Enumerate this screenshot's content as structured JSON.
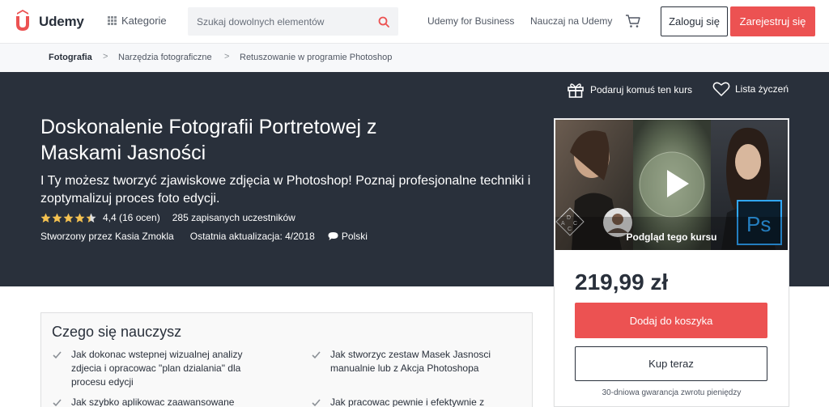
{
  "header": {
    "logo_text": "Udemy",
    "categories_label": "Kategorie",
    "search_placeholder": "Szukaj dowolnych elementów",
    "business_link": "Udemy for Business",
    "teach_link": "Nauczaj na Udemy",
    "login_label": "Zaloguj się",
    "register_label": "Zarejestruj się"
  },
  "breadcrumb": [
    "Fotografia",
    "Narzędzia fotograficzne",
    "Retuszowanie w programie Photoshop"
  ],
  "hero": {
    "gift_label": "Podaruj komuś ten kurs",
    "wishlist_label": "Lista życzeń",
    "title_line1": "Doskonalenie Fotografii Portretowej z",
    "title_line2": "Maskami Jasności",
    "subtitle": "I Ty możesz tworzyć zjawiskowe zdjęcia w Photoshop! Poznaj profesjonalne techniki i zoptymalizuj proces foto edycji.",
    "rating_value": 4.4,
    "rating_text": "4,4 (16 ocen)",
    "students_text": "285 zapisanych uczestników",
    "author_text": "Stworzony przez Kasia Zmokla",
    "updated_text": "Ostatnia aktualizacja: 4/2018",
    "language": "Polski"
  },
  "card": {
    "preview_label": "Podgląd tego kursu",
    "price": "219,99 zł",
    "add_to_cart": "Dodaj do koszyka",
    "buy_now": "Kup teraz",
    "guarantee": "30-dniowa gwarancja zwrotu pieniędzy"
  },
  "learn": {
    "title": "Czego się nauczysz",
    "items": [
      "Jak dokonac wstepnej wizualnej analizy zdjecia i opracowac \"plan dzialania\" dla procesu edycji",
      "Jak stworzyc zestaw Masek Jasnosci manualnie lub z Akcja Photoshopa",
      "Jak szybko aplikowac zaawansowane",
      "Jak pracowac pewnie i efektywnie z"
    ]
  },
  "colors": {
    "accent": "#ec5252",
    "hero_bg": "#29303b",
    "star": "#f4c150"
  },
  "icons": [
    "udemy-logo-icon",
    "grid-icon",
    "search-icon",
    "cart-icon",
    "gift-icon",
    "heart-icon",
    "star-icon",
    "speech-bubble-icon",
    "play-icon",
    "check-icon"
  ]
}
